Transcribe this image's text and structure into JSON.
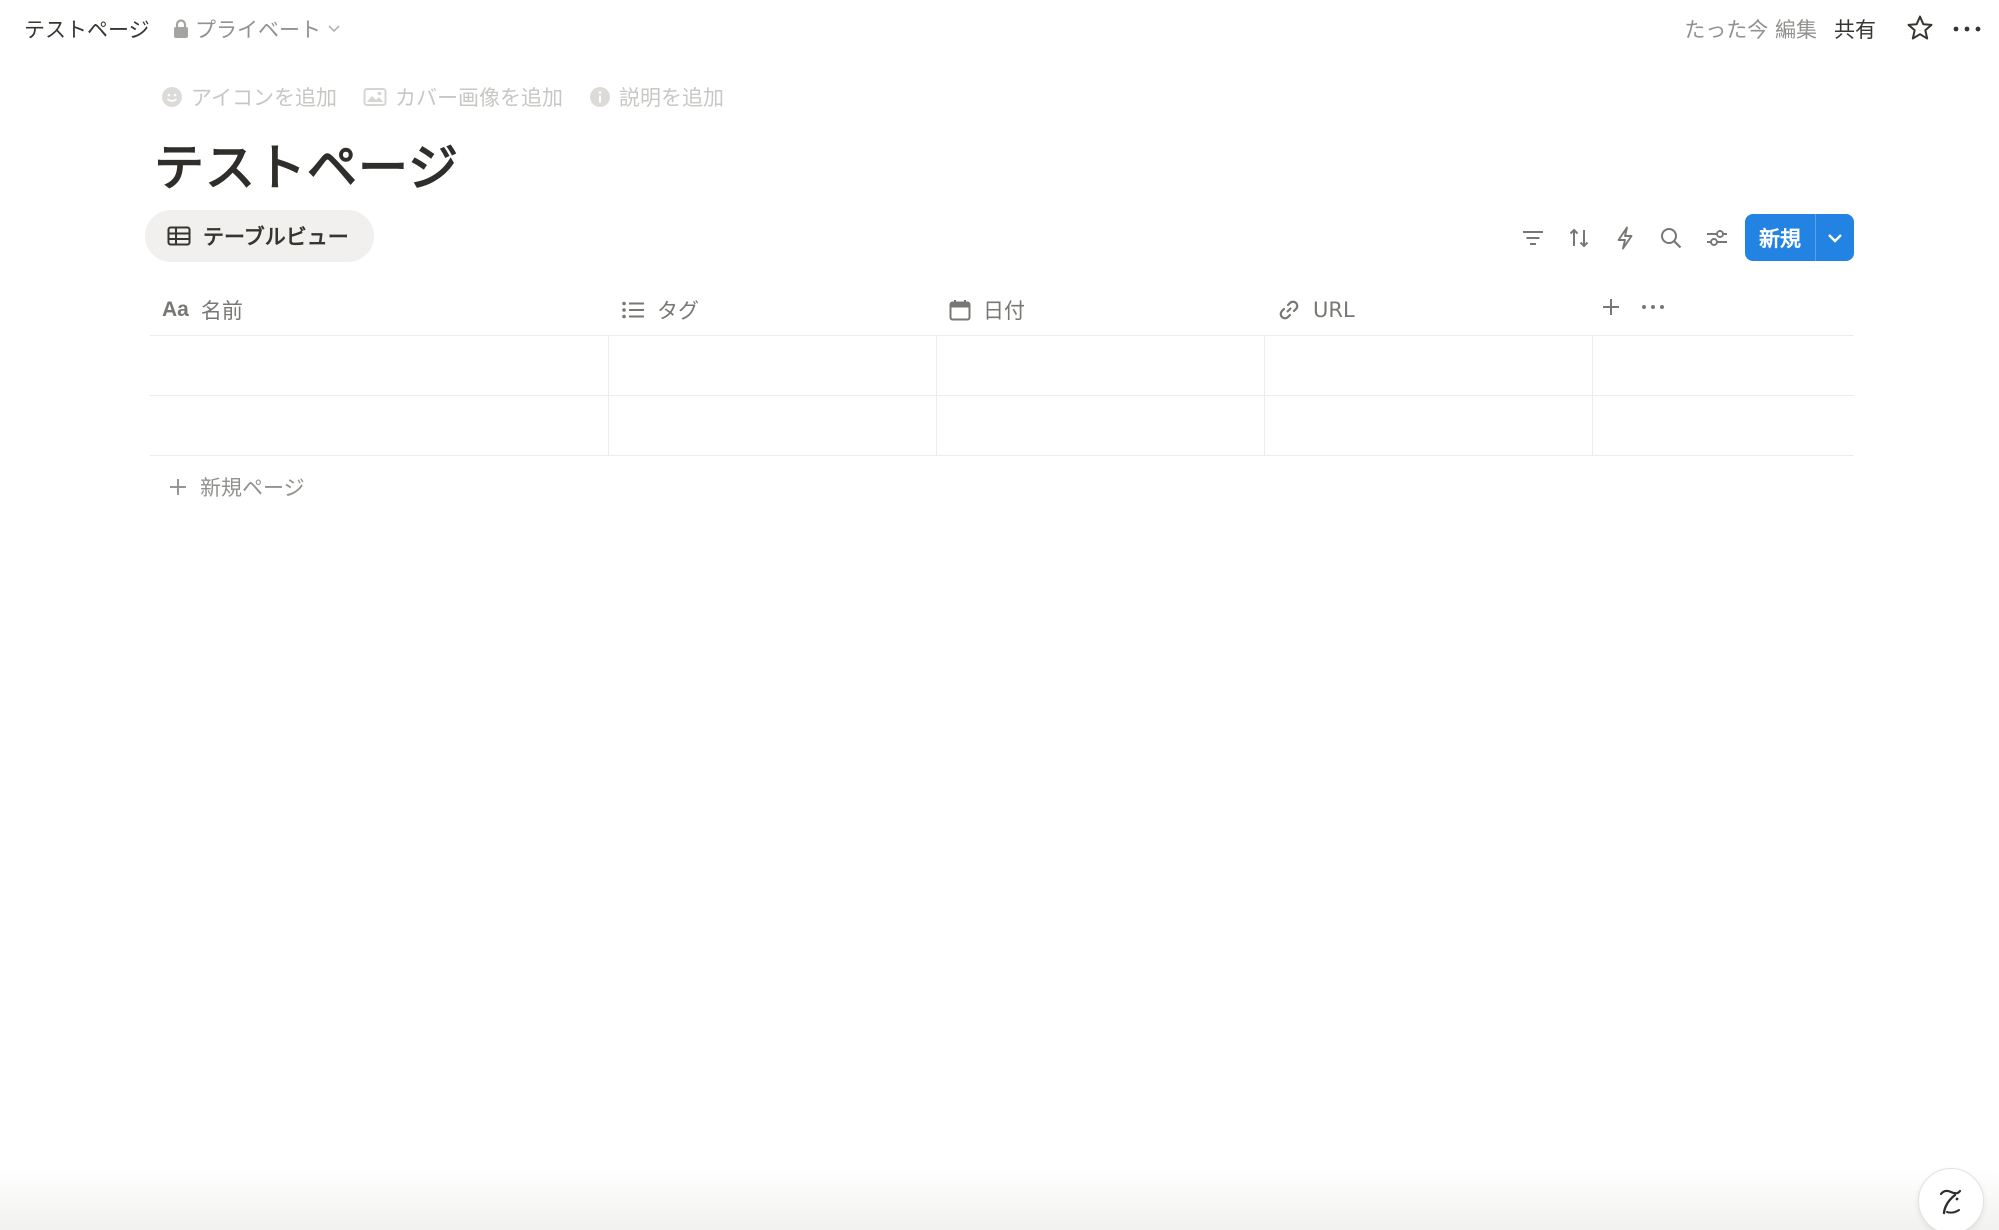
{
  "topbar": {
    "breadcrumb_title": "テストページ",
    "privacy_label": "プライベート",
    "edited_label": "たった今 編集",
    "share_label": "共有"
  },
  "page": {
    "actions": [
      "アイコンを追加",
      "カバー画像を追加",
      "説明を追加"
    ],
    "title": "テストページ"
  },
  "view": {
    "tab_label": "テーブルビュー",
    "new_button_label": "新規"
  },
  "table": {
    "columns": [
      {
        "label": "名前",
        "icon": "text-type-icon"
      },
      {
        "label": "タグ",
        "icon": "list-icon"
      },
      {
        "label": "日付",
        "icon": "calendar-icon"
      },
      {
        "label": "URL",
        "icon": "link-icon"
      }
    ],
    "rows": [
      {
        "name": "",
        "tag": "",
        "date": "",
        "url": ""
      },
      {
        "name": "",
        "tag": "",
        "date": "",
        "url": ""
      }
    ],
    "new_page_label": "新規ページ"
  },
  "colors": {
    "accent": "#2383e2",
    "text": "#37352f",
    "muted": "#91918e",
    "placeholder": "#c8c7c4",
    "border": "#ececeb",
    "tab_bg": "#f1f0ee"
  }
}
